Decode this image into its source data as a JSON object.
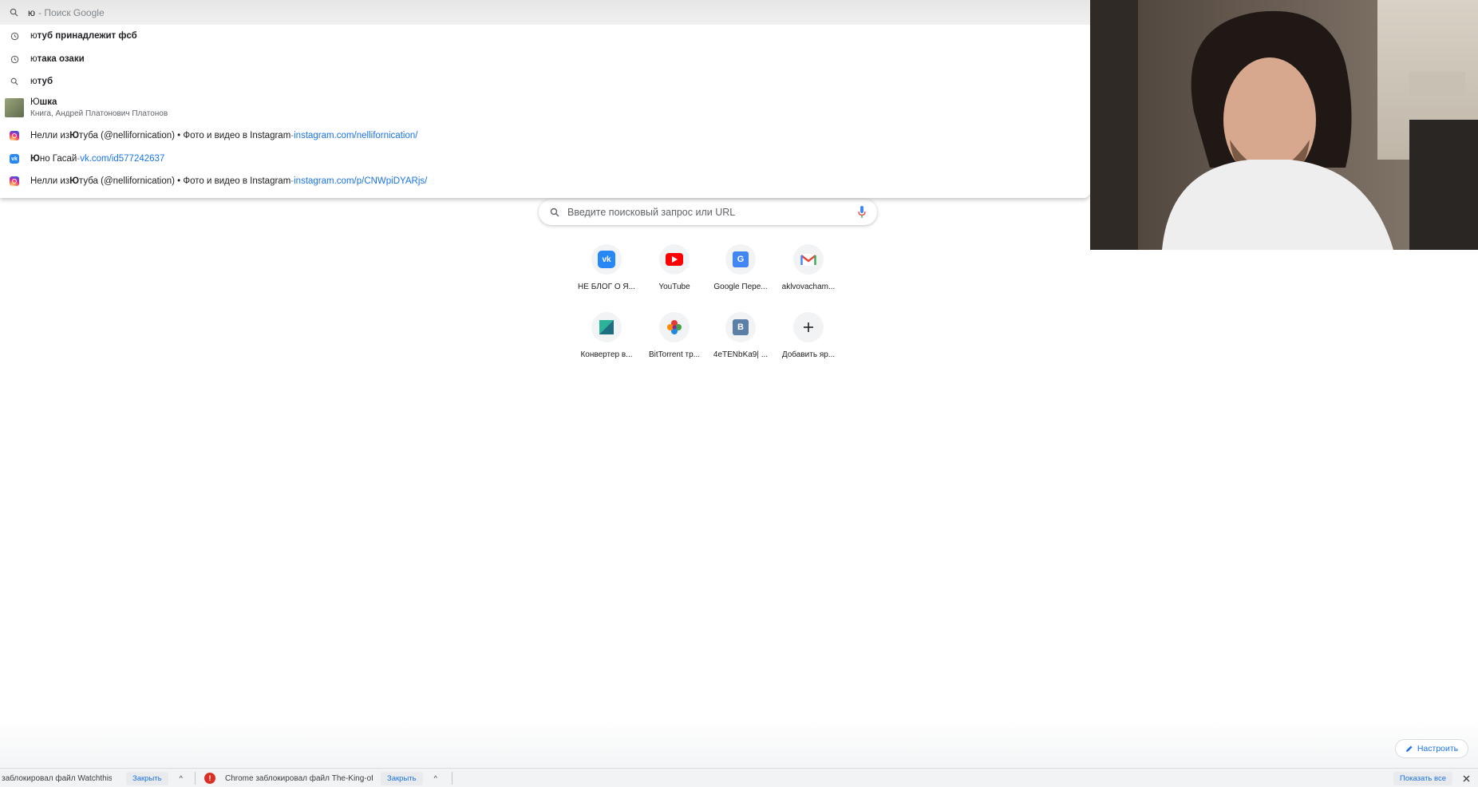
{
  "omnibox": {
    "typed": "ю",
    "hint": "- Поиск Google",
    "suggestions": [
      {
        "prefix": "ю",
        "bold": "туб принадлежит фсб"
      },
      {
        "prefix": "ю",
        "bold": "така озаки"
      },
      {
        "prefix": "ю",
        "bold": "туб"
      },
      {
        "prefix": "Ю",
        "bold": "шка",
        "sub": "Книга, Андрей Платонович Платонов"
      },
      {
        "pre": "Нелли из ",
        "bold": "Ю",
        "post": "туба (@nellifornication) • Фото и видео в Instagram",
        "sep": " - ",
        "url": "instagram.com/nellifornication/"
      },
      {
        "bold": "Ю",
        "post": "но Гасай",
        "sep": " - ",
        "url": "vk.com/id577242637"
      },
      {
        "pre": "Нелли из ",
        "bold": "Ю",
        "post": "туба (@nellifornication) • Фото и видео в Instagram",
        "sep": " - ",
        "url": "instagram.com/p/CNWpiDYARjs/"
      }
    ]
  },
  "search": {
    "placeholder": "Введите поисковый запрос или URL"
  },
  "shortcuts": [
    {
      "label": "НЕ БЛОГ О Я..."
    },
    {
      "label": "YouTube"
    },
    {
      "label": "Google Пере..."
    },
    {
      "label": "aklvovacham..."
    },
    {
      "label": "Конвертер в..."
    },
    {
      "label": "BitTorrent тр..."
    },
    {
      "label": "4eTENbKa9| ..."
    },
    {
      "label": "Добавить яр..."
    }
  ],
  "customize": {
    "label": "Настроить"
  },
  "downloads": {
    "item1": {
      "text": "заблокировал файл Watchthis",
      "close": "Закрыть"
    },
    "item2": {
      "text": "Chrome заблокировал файл The-King-of-",
      "close": "Закрыть"
    },
    "show_all": "Показать все"
  }
}
